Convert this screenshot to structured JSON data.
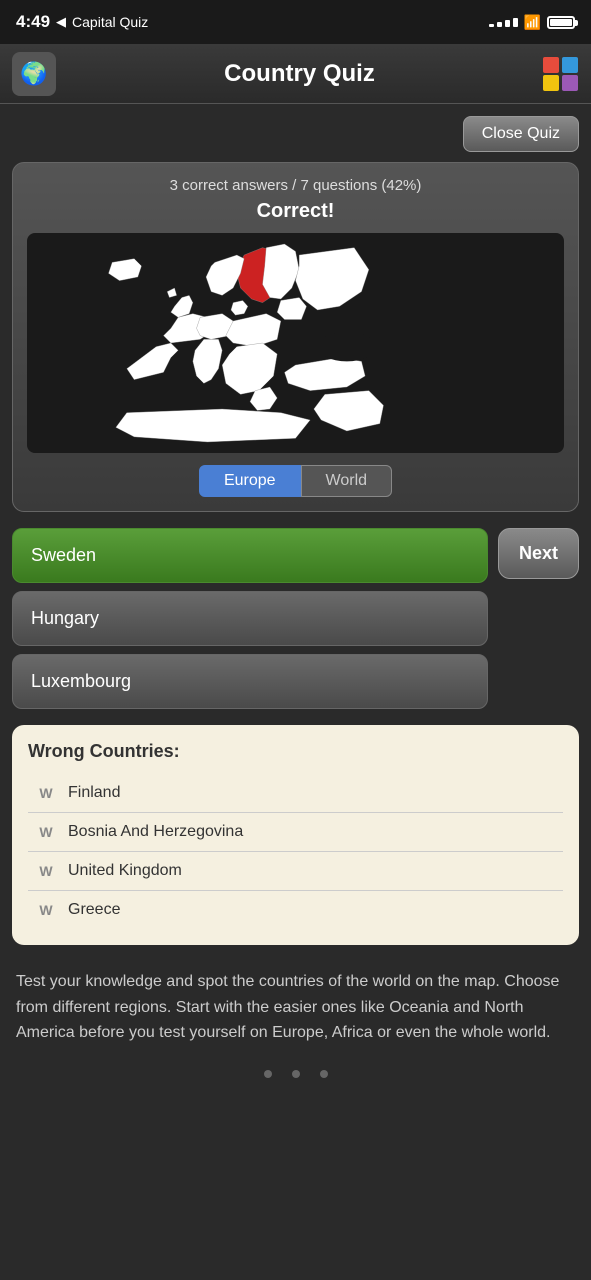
{
  "statusBar": {
    "time": "4:49",
    "backLabel": "Capital Quiz",
    "signalBars": [
      3,
      5,
      7,
      9,
      11
    ],
    "wifiSymbol": "wifi"
  },
  "header": {
    "title": "Country Quiz",
    "logoEmoji": "🌍"
  },
  "colorGrid": [
    {
      "color": "#e74c3c"
    },
    {
      "color": "#3498db"
    },
    {
      "color": "#f1c40f"
    },
    {
      "color": "#9b59b6"
    }
  ],
  "closeButton": "Close Quiz",
  "quiz": {
    "stats": "3 correct answers / 7 questions (42%)",
    "resultLabel": "Correct!",
    "tabs": [
      {
        "label": "Europe",
        "active": true
      },
      {
        "label": "World",
        "active": false
      }
    ]
  },
  "answers": [
    {
      "label": "Sweden",
      "correct": true
    },
    {
      "label": "Hungary",
      "correct": false
    },
    {
      "label": "Luxembourg",
      "correct": false
    }
  ],
  "nextButton": "Next",
  "wrongCountries": {
    "title": "Wrong Countries:",
    "items": [
      {
        "label": "Finland"
      },
      {
        "label": "Bosnia And Herzegovina"
      },
      {
        "label": "United Kingdom"
      },
      {
        "label": "Greece"
      }
    ],
    "iconLabel": "W"
  },
  "descriptionText": "Test your knowledge and spot the countries of the world on the map. Choose from different regions. Start with the easier ones like Oceania and North America before you test yourself on Europe, Africa or even the whole world."
}
